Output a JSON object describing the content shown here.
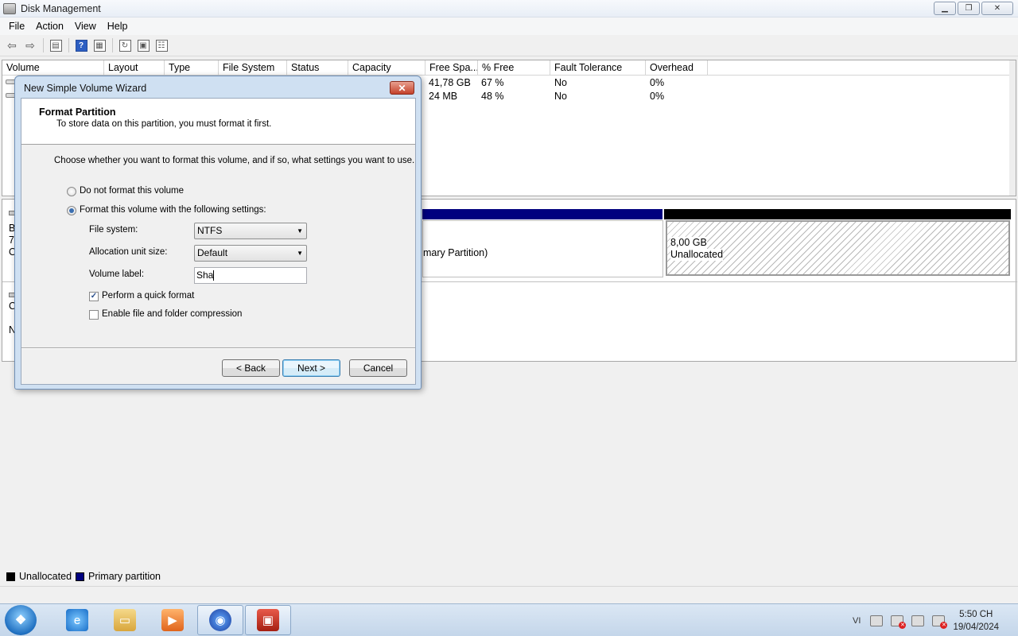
{
  "window": {
    "title": "Disk Management",
    "min_icon": "minimize-icon",
    "max_icon": "restore-icon",
    "close_icon": "close-icon"
  },
  "menu": [
    "File",
    "Action",
    "View",
    "Help"
  ],
  "toolbar": {
    "icons": [
      "back-arrow-icon",
      "forward-arrow-icon",
      "show-hide-console-tree-icon",
      "help-icon",
      "properties-icon",
      "refresh-icon",
      "rescan-disks-icon",
      "export-list-icon"
    ],
    "help_glyph": "?"
  },
  "volume_list": {
    "columns": [
      "Volume",
      "Layout",
      "Type",
      "File System",
      "Status",
      "Capacity",
      "Free Spa...",
      "% Free",
      "Fault Tolerance",
      "Overhead"
    ],
    "rows": [
      {
        "free_space": "41,78 GB",
        "percent_free": "67 %",
        "fault_tolerance": "No",
        "overhead": "0%"
      },
      {
        "free_space": "24 MB",
        "percent_free": "48 %",
        "fault_tolerance": "No",
        "overhead": "0%"
      }
    ]
  },
  "disk_map": {
    "disk0_label_lines": [
      "B",
      "70",
      "O"
    ],
    "disk1_label_lines": [
      "C",
      "N"
    ],
    "primary_partition_fragment": "mary Partition)",
    "unallocated_size": "8,00 GB",
    "unallocated_label": "Unallocated",
    "colors": {
      "primary": "#00007f",
      "unallocated": "#000000"
    }
  },
  "legend": [
    {
      "label": "Unallocated",
      "color": "#000000"
    },
    {
      "label": "Primary partition",
      "color": "#00007f"
    }
  ],
  "dialog": {
    "title": "New Simple Volume Wizard",
    "close_glyph": "✕",
    "header_title": "Format Partition",
    "header_subtitle": "To store data on this partition, you must format it first.",
    "instruction": "Choose whether you want to format this volume, and if so, what settings you want to use.",
    "option_no_format": "Do not format this volume",
    "option_format": "Format this volume with the following settings:",
    "file_system_label": "File system:",
    "file_system_value": "NTFS",
    "allocation_label": "Allocation unit size:",
    "allocation_value": "Default",
    "volume_label_label": "Volume label:",
    "volume_label_value": "Sha",
    "quick_format_label": "Perform a quick format",
    "quick_format_checked": true,
    "compression_label": "Enable file and folder compression",
    "compression_checked": false,
    "back_button": "< Back",
    "next_button": "Next >",
    "cancel_button": "Cancel"
  },
  "taskbar": {
    "apps": [
      "internet-explorer-icon",
      "file-explorer-icon",
      "media-player-icon",
      "firefox-icon",
      "computer-management-toolbox-icon"
    ],
    "language": "VI",
    "time": "5:50 CH",
    "date": "19/04/2024"
  }
}
